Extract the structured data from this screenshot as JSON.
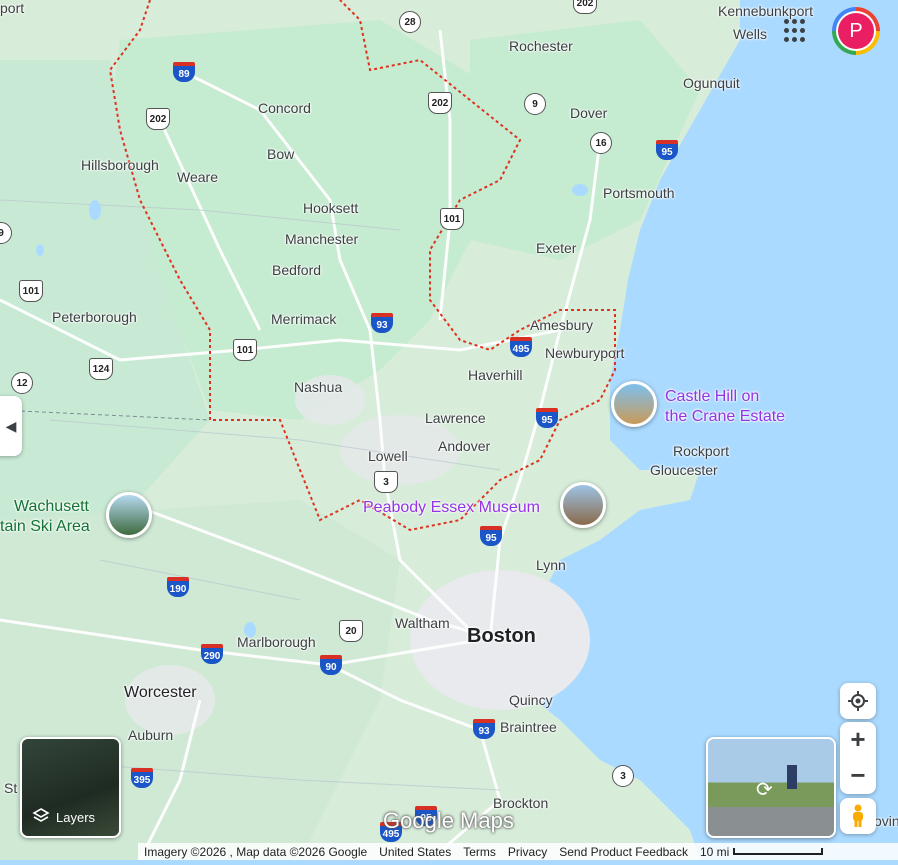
{
  "map": {
    "places": {
      "kennebunkport": "Kennebunkport",
      "wells": "Wells",
      "rochester": "Rochester",
      "ogunquit": "Ogunquit",
      "concord": "Concord",
      "dover": "Dover",
      "hillsborough": "Hillsborough",
      "bow": "Bow",
      "weare": "Weare",
      "portsmouth": "Portsmouth",
      "hooksett": "Hooksett",
      "manchester": "Manchester",
      "exeter": "Exeter",
      "bedford": "Bedford",
      "peterborough": "Peterborough",
      "merrimack": "Merrimack",
      "amesbury": "Amesbury",
      "newburyport": "Newburyport",
      "haverhill": "Haverhill",
      "nashua": "Nashua",
      "lawrence": "Lawrence",
      "andover": "Andover",
      "rockport": "Rockport",
      "gloucester": "Gloucester",
      "lowell": "Lowell",
      "lynn": "Lynn",
      "waltham": "Waltham",
      "boston": "Boston",
      "marlborough": "Marlborough",
      "worcester": "Worcester",
      "quincy": "Quincy",
      "braintree": "Braintree",
      "auburn": "Auburn",
      "brockton": "Brockton",
      "port": "port",
      "st": "St",
      "ovin": "ovin"
    },
    "pois": {
      "castle_hill": "Castle Hill on the Crane Estate",
      "castle_hill_line1": "Castle Hill on",
      "castle_hill_line2": "the Crane Estate",
      "peabody": "Peabody Essex Museum",
      "wachusett_line1": "Wachusett",
      "wachusett_line2": "tain Ski Area"
    },
    "shields": {
      "r28": "28",
      "r202a": "202",
      "r89": "89",
      "r202b": "202",
      "r202c": "202",
      "r9": "9",
      "r16": "16",
      "r95a": "95",
      "r101a": "101",
      "r101b": "101",
      "r101c": "101",
      "r9b": "9",
      "r93a": "93",
      "r495": "495",
      "r12": "12",
      "r124": "124",
      "r95b": "95",
      "r3a": "3",
      "r95c": "95",
      "r190": "190",
      "r290": "290",
      "r20": "20",
      "r90": "90",
      "r93b": "93",
      "r3b": "3",
      "r395": "395",
      "r95d": "95",
      "r495b": "495"
    }
  },
  "controls": {
    "account_initial": "P",
    "layers_label": "Layers",
    "zoom_in": "+",
    "zoom_out": "−"
  },
  "logo": "Google Maps",
  "footer": {
    "imagery": "Imagery ©2026 , Map data ©2026 Google",
    "country": "United States",
    "terms": "Terms",
    "privacy": "Privacy",
    "feedback": "Send Product Feedback",
    "scale": "10 mi"
  },
  "colors": {
    "water": "#aadaff",
    "land": "#e8f0e6",
    "park": "#bfe6c8",
    "state_border": "#e0301e",
    "interstate": "#1a56c7",
    "poi_text": "#9334e6",
    "account_bg": "#e91e63"
  }
}
